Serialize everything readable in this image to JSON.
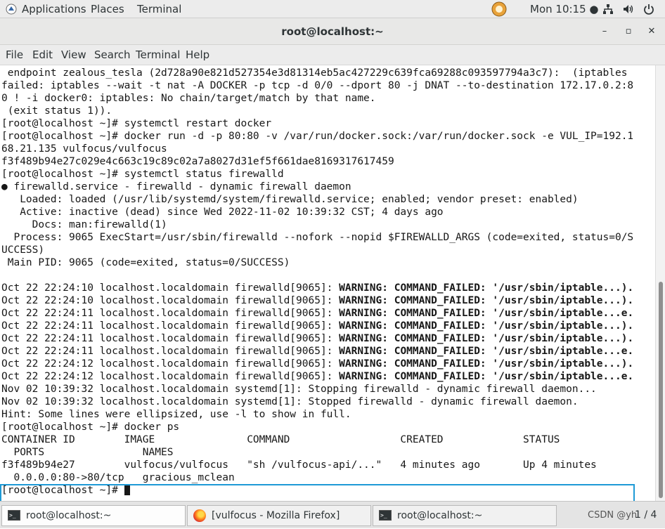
{
  "topbar": {
    "applications": "Applications",
    "places": "Places",
    "terminal": "Terminal",
    "clock": "Mon 10:15 ●",
    "icons": [
      "network-icon",
      "volume-icon",
      "power-icon"
    ]
  },
  "window": {
    "title": "root@localhost:~",
    "minimize": "–",
    "maximize": "▫",
    "close": "✕"
  },
  "menu": {
    "items": [
      "File",
      "Edit",
      "View",
      "Search",
      "Terminal",
      "Help"
    ]
  },
  "terminal": {
    "lines": [
      " endpoint zealous_tesla (2d728a90e821d527354e3d81314eb5ac427229c639fca69288c093597794a3c7):  (iptables",
      "failed: iptables --wait -t nat -A DOCKER -p tcp -d 0/0 --dport 80 -j DNAT --to-destination 172.17.0.2:8",
      "0 ! -i docker0: iptables: No chain/target/match by that name.",
      " (exit status 1)).",
      "[root@localhost ~]# systemctl restart docker",
      "[root@localhost ~]# docker run -d -p 80:80 -v /var/run/docker.sock:/var/run/docker.sock -e VUL_IP=192.1",
      "68.21.135 vulfocus/vulfocus",
      "f3f489b94e27c029e4c663c19c89c02a7a8027d31ef5f661dae8169317617459",
      "[root@localhost ~]# systemctl status firewalld",
      "● firewalld.service - firewalld - dynamic firewall daemon",
      "   Loaded: loaded (/usr/lib/systemd/system/firewalld.service; enabled; vendor preset: enabled)",
      "   Active: inactive (dead) since Wed 2022-11-02 10:39:32 CST; 4 days ago",
      "     Docs: man:firewalld(1)",
      "  Process: 9065 ExecStart=/usr/sbin/firewalld --nofork --nopid $FIREWALLD_ARGS (code=exited, status=0/S",
      "UCCESS)",
      " Main PID: 9065 (code=exited, status=0/SUCCESS)",
      "",
      "Oct 22 22:24:10 localhost.localdomain firewalld[9065]: ",
      "Oct 22 22:24:10 localhost.localdomain firewalld[9065]: ",
      "Oct 22 22:24:11 localhost.localdomain firewalld[9065]: ",
      "Oct 22 22:24:11 localhost.localdomain firewalld[9065]: ",
      "Oct 22 22:24:11 localhost.localdomain firewalld[9065]: ",
      "Oct 22 22:24:11 localhost.localdomain firewalld[9065]: ",
      "Oct 22 22:24:12 localhost.localdomain firewalld[9065]: ",
      "Oct 22 22:24:12 localhost.localdomain firewalld[9065]: ",
      "Nov 02 10:39:32 localhost.localdomain systemd[1]: Stopping firewalld - dynamic firewall daemon...",
      "Nov 02 10:39:32 localhost.localdomain systemd[1]: Stopped firewalld - dynamic firewall daemon.",
      "Hint: Some lines were ellipsized, use -l to show in full.",
      "[root@localhost ~]# docker ps",
      "CONTAINER ID        IMAGE               COMMAND                  CREATED             STATUS",
      "  PORTS                NAMES",
      "f3f489b94e27        vulfocus/vulfocus   \"sh /vulfocus-api/...\"   4 minutes ago       Up 4 minutes",
      "  0.0.0.0:80->80/tcp   gracious_mclean",
      "[root@localhost ~]# "
    ],
    "bold": {
      "17": "WARNING: COMMAND_FAILED: '/usr/sbin/iptable...).",
      "18": "WARNING: COMMAND_FAILED: '/usr/sbin/iptable...).",
      "19": "WARNING: COMMAND_FAILED: '/usr/sbin/iptable...e.",
      "20": "WARNING: COMMAND_FAILED: '/usr/sbin/iptable...).",
      "21": "WARNING: COMMAND_FAILED: '/usr/sbin/iptable...).",
      "22": "WARNING: COMMAND_FAILED: '/usr/sbin/iptable...e.",
      "23": "WARNING: COMMAND_FAILED: '/usr/sbin/iptable...).",
      "24": "WARNING: COMMAND_FAILED: '/usr/sbin/iptable...e."
    }
  },
  "taskbar": {
    "tasks": [
      {
        "label": "root@localhost:~",
        "icon": "terminal-icon"
      },
      {
        "label": "[vulfocus - Mozilla Firefox]",
        "icon": "firefox-icon"
      },
      {
        "label": "root@localhost:~",
        "icon": "terminal-icon"
      }
    ],
    "watermark": "CSDN @yh",
    "pager": "1 / 4"
  },
  "colors": {
    "highlight": "#1e9ad6",
    "terminal_bg": "#ffffff",
    "terminal_fg": "#171717"
  }
}
